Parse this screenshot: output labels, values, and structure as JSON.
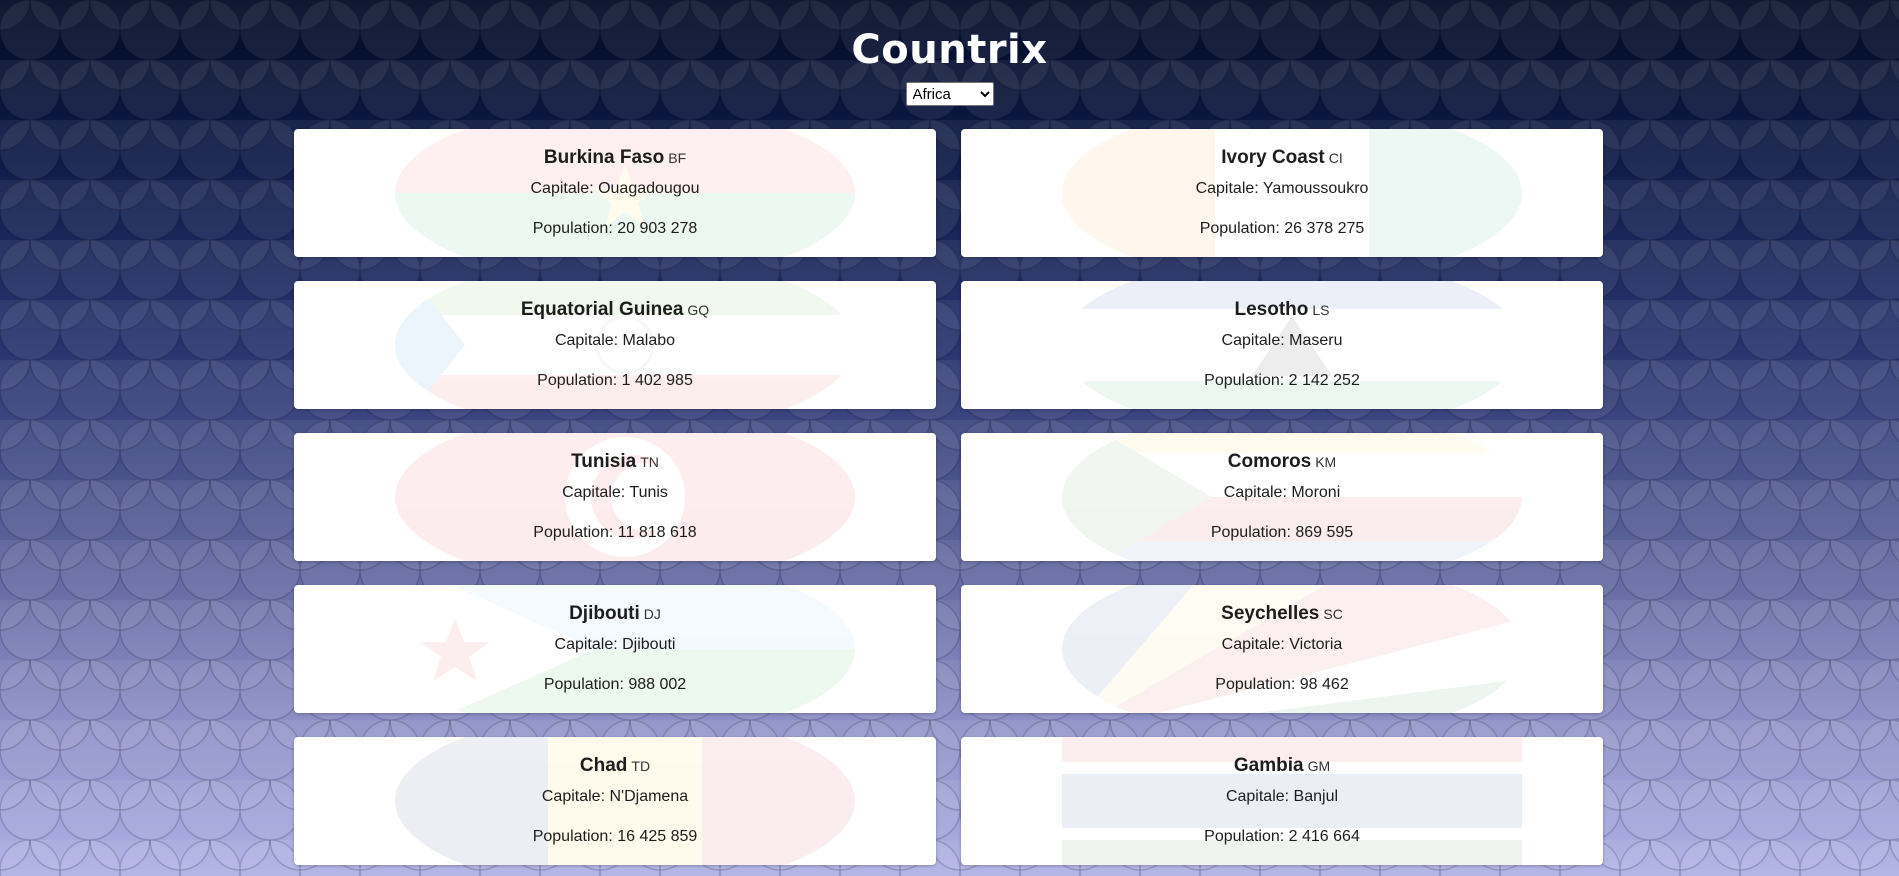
{
  "app": {
    "title": "Countrix",
    "region_select": {
      "selected": "Africa"
    }
  },
  "countries": [
    {
      "name": "Burkina Faso",
      "code": "BF",
      "capital": "Capitale: Ouagadougou",
      "population": "Population: 20 903 278"
    },
    {
      "name": "Ivory Coast",
      "code": "CI",
      "capital": "Capitale: Yamoussoukro",
      "population": "Population: 26 378 275"
    },
    {
      "name": "Equatorial Guinea",
      "code": "GQ",
      "capital": "Capitale: Malabo",
      "population": "Population: 1 402 985"
    },
    {
      "name": "Lesotho",
      "code": "LS",
      "capital": "Capitale: Maseru",
      "population": "Population: 2 142 252"
    },
    {
      "name": "Tunisia",
      "code": "TN",
      "capital": "Capitale: Tunis",
      "population": "Population: 11 818 618"
    },
    {
      "name": "Comoros",
      "code": "KM",
      "capital": "Capitale: Moroni",
      "population": "Population: 869 595"
    },
    {
      "name": "Djibouti",
      "code": "DJ",
      "capital": "Capitale: Djibouti",
      "population": "Population: 988 002"
    },
    {
      "name": "Seychelles",
      "code": "SC",
      "capital": "Capitale: Victoria",
      "population": "Population: 98 462"
    },
    {
      "name": "Chad",
      "code": "TD",
      "capital": "Capitale: N'Djamena",
      "population": "Population: 16 425 859"
    },
    {
      "name": "Gambia",
      "code": "GM",
      "capital": "Capitale: Banjul",
      "population": "Population: 2 416 664"
    }
  ],
  "colors": {
    "background_top": "#010a24",
    "background_bottom": "#aeb0e5",
    "card": "#ffffff",
    "title": "#ffffff"
  }
}
